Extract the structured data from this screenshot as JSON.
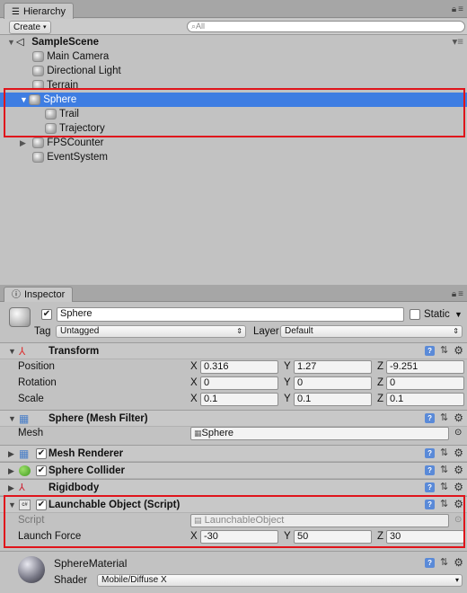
{
  "hierarchy": {
    "tab_label": "Hierarchy",
    "create_label": "Create",
    "search_placeholder": "All",
    "scene_name": "SampleScene",
    "items": [
      "Main Camera",
      "Directional Light",
      "Terrain",
      "Sphere",
      "Trail",
      "Trajectory",
      "FPSCounter",
      "EventSystem"
    ]
  },
  "inspector": {
    "tab_label": "Inspector",
    "object_name": "Sphere",
    "static_label": "Static",
    "tag_label": "Tag",
    "tag_value": "Untagged",
    "layer_label": "Layer",
    "layer_value": "Default",
    "transform": {
      "title": "Transform",
      "position_label": "Position",
      "rotation_label": "Rotation",
      "scale_label": "Scale",
      "position": {
        "x": "0.316",
        "y": "1.27",
        "z": "-9.251"
      },
      "rotation": {
        "x": "0",
        "y": "0",
        "z": "0"
      },
      "scale": {
        "x": "0.1",
        "y": "0.1",
        "z": "0.1"
      }
    },
    "mesh_filter": {
      "title": "Sphere (Mesh Filter)",
      "mesh_label": "Mesh",
      "mesh_value": "Sphere"
    },
    "mesh_renderer": {
      "title": "Mesh Renderer"
    },
    "sphere_collider": {
      "title": "Sphere Collider"
    },
    "rigidbody": {
      "title": "Rigidbody"
    },
    "launchable": {
      "title": "Launchable Object (Script)",
      "script_label": "Script",
      "script_value": "LaunchableObject",
      "force_label": "Launch Force",
      "force": {
        "x": "-30",
        "y": "50",
        "z": "30"
      }
    },
    "material": {
      "name": "SphereMaterial",
      "shader_label": "Shader",
      "shader_value": "Mobile/Diffuse X"
    },
    "axis_x": "X",
    "axis_y": "Y",
    "axis_z": "Z"
  }
}
